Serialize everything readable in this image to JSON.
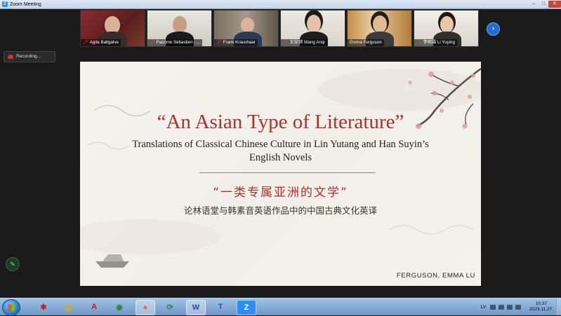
{
  "window": {
    "title": "Zoom Meeting",
    "minimize": "–",
    "maximize": "□",
    "close": "✕"
  },
  "participants": [
    {
      "name": "Agita Baltgalve"
    },
    {
      "name": "Pacôme Sébastien - ..."
    },
    {
      "name": "Frank Kraushaar"
    },
    {
      "name": "王安琪  Wang Anqi"
    },
    {
      "name": "Emma Ferguson"
    },
    {
      "name": "李雨霖  Li Yuying"
    }
  ],
  "video_nav": {
    "next_label": "›"
  },
  "recording": {
    "label": "Recording..."
  },
  "slide": {
    "title": "“An Asian Type of Literature”",
    "subtitle": "Translations of Classical Chinese Culture in Lin Yutang and Han Suyin’s English Novels",
    "cn_title": "“一类专属亚洲的文学”",
    "cn_subtitle": "论林语堂与韩素音英语作品中的中国古典文化英译",
    "author": "FERGUSON, EMMA LU"
  },
  "annotate": {
    "icon": "pencil-icon",
    "glyph": "✎"
  },
  "taskbar": {
    "apps": [
      {
        "icon": "jigsaw-icon",
        "glyph": "✱"
      },
      {
        "icon": "folder-icon",
        "glyph": "▤"
      },
      {
        "icon": "acrobat-icon",
        "glyph": "A"
      },
      {
        "icon": "chrome-icon",
        "glyph": "◉"
      },
      {
        "icon": "firefox-icon",
        "glyph": "●"
      },
      {
        "icon": "sync-icon",
        "glyph": "⟳"
      },
      {
        "icon": "word-icon",
        "glyph": "W"
      },
      {
        "icon": "teams-icon",
        "glyph": "T"
      },
      {
        "icon": "zoom-icon",
        "glyph": "Z"
      }
    ],
    "language": "LV",
    "time": "10:37",
    "date": "2023.11.27."
  },
  "colors": {
    "accent_red": "#a8322e",
    "zoom_blue": "#1f6fd1"
  }
}
